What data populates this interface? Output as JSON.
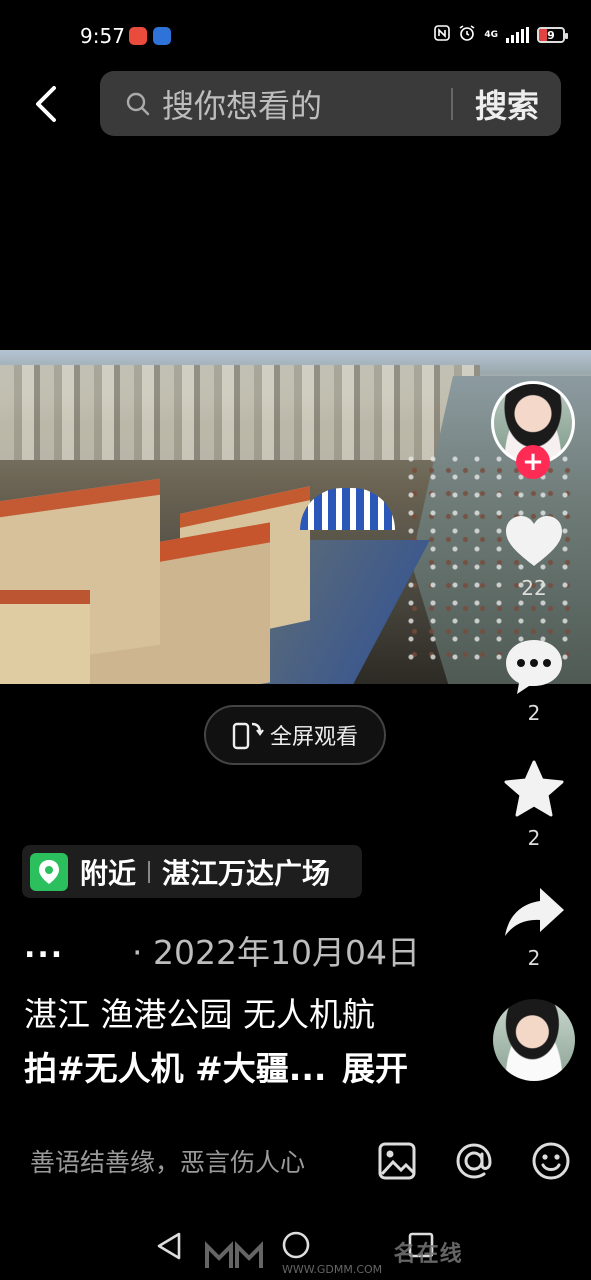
{
  "status_bar": {
    "time": "9:57",
    "network": "4G",
    "battery_level": "9",
    "icons": [
      "nfc-icon",
      "alarm-icon",
      "signal-icon",
      "battery-icon"
    ]
  },
  "search": {
    "placeholder": "搜你想看的",
    "button_label": "搜索"
  },
  "video": {
    "fullscreen_label": "全屏观看"
  },
  "actions": {
    "likes": "22",
    "comments": "2",
    "favorites": "2",
    "shares": "2",
    "follow_symbol": "+"
  },
  "location": {
    "nearby": "附近",
    "place": "湛江万达广场"
  },
  "description": {
    "ellipsis": "...",
    "date": "· 2022年10月04日",
    "line1": "湛江 渔港公园 无人机航",
    "line2": "拍#无人机 #大疆...",
    "expand": "展开"
  },
  "comment_bar": {
    "placeholder": "善语结善缘，恶言伤人心"
  },
  "watermark": {
    "brand": "名在线",
    "url": "WWW.GDMM.COM"
  },
  "colors": {
    "accent_pink": "#fe2c55",
    "location_green": "#2bbf5d",
    "background": "#000000"
  }
}
